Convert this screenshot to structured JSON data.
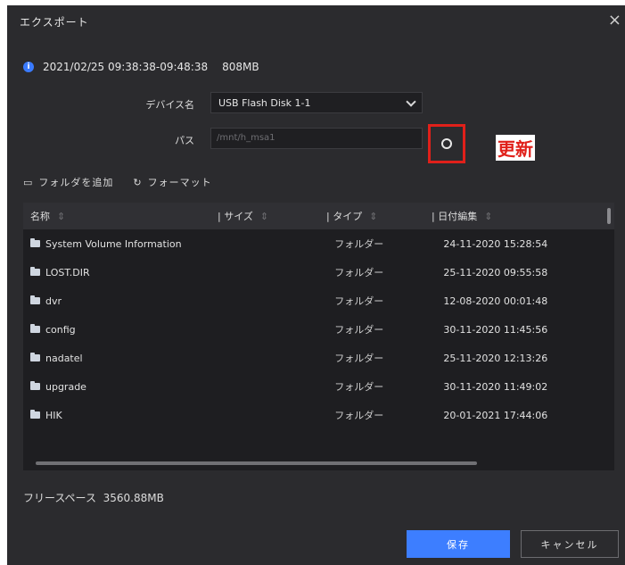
{
  "dialog": {
    "title": "エクスポート",
    "close_glyph": "×"
  },
  "info": {
    "icon_glyph": "i",
    "time_range": "2021/02/25 09:38:38-09:48:38",
    "size": "808MB"
  },
  "device": {
    "label": "デバイス名",
    "value": "USB Flash Disk 1-1"
  },
  "path": {
    "label": "パス",
    "value": "/mnt/h_msa1"
  },
  "annotation": {
    "refresh_label": "更新",
    "color": "#e0201a"
  },
  "toolbar": {
    "add_folder": "フォルダを追加",
    "format": "フォーマット"
  },
  "table": {
    "headers": [
      "名称",
      "サイズ",
      "タイプ",
      "日付編集"
    ],
    "rows": [
      {
        "name": "System Volume Information",
        "size": "",
        "type": "フォルダー",
        "date": "24-11-2020 15:28:54"
      },
      {
        "name": "LOST.DIR",
        "size": "",
        "type": "フォルダー",
        "date": "25-11-2020 09:55:58"
      },
      {
        "name": "dvr",
        "size": "",
        "type": "フォルダー",
        "date": "12-08-2020 00:01:48"
      },
      {
        "name": "config",
        "size": "",
        "type": "フォルダー",
        "date": "30-11-2020 11:45:56"
      },
      {
        "name": "nadatel",
        "size": "",
        "type": "フォルダー",
        "date": "25-11-2020 12:13:26"
      },
      {
        "name": "upgrade",
        "size": "",
        "type": "フォルダー",
        "date": "30-11-2020 11:49:02"
      },
      {
        "name": "HIK",
        "size": "",
        "type": "フォルダー",
        "date": "20-01-2021 17:44:06"
      }
    ]
  },
  "free_space": {
    "label": "フリースペース",
    "value": "3560.88MB"
  },
  "buttons": {
    "save": "保存",
    "cancel": "キャンセル"
  },
  "colors": {
    "accent": "#3d7eff",
    "background": "#2b2b2e"
  }
}
